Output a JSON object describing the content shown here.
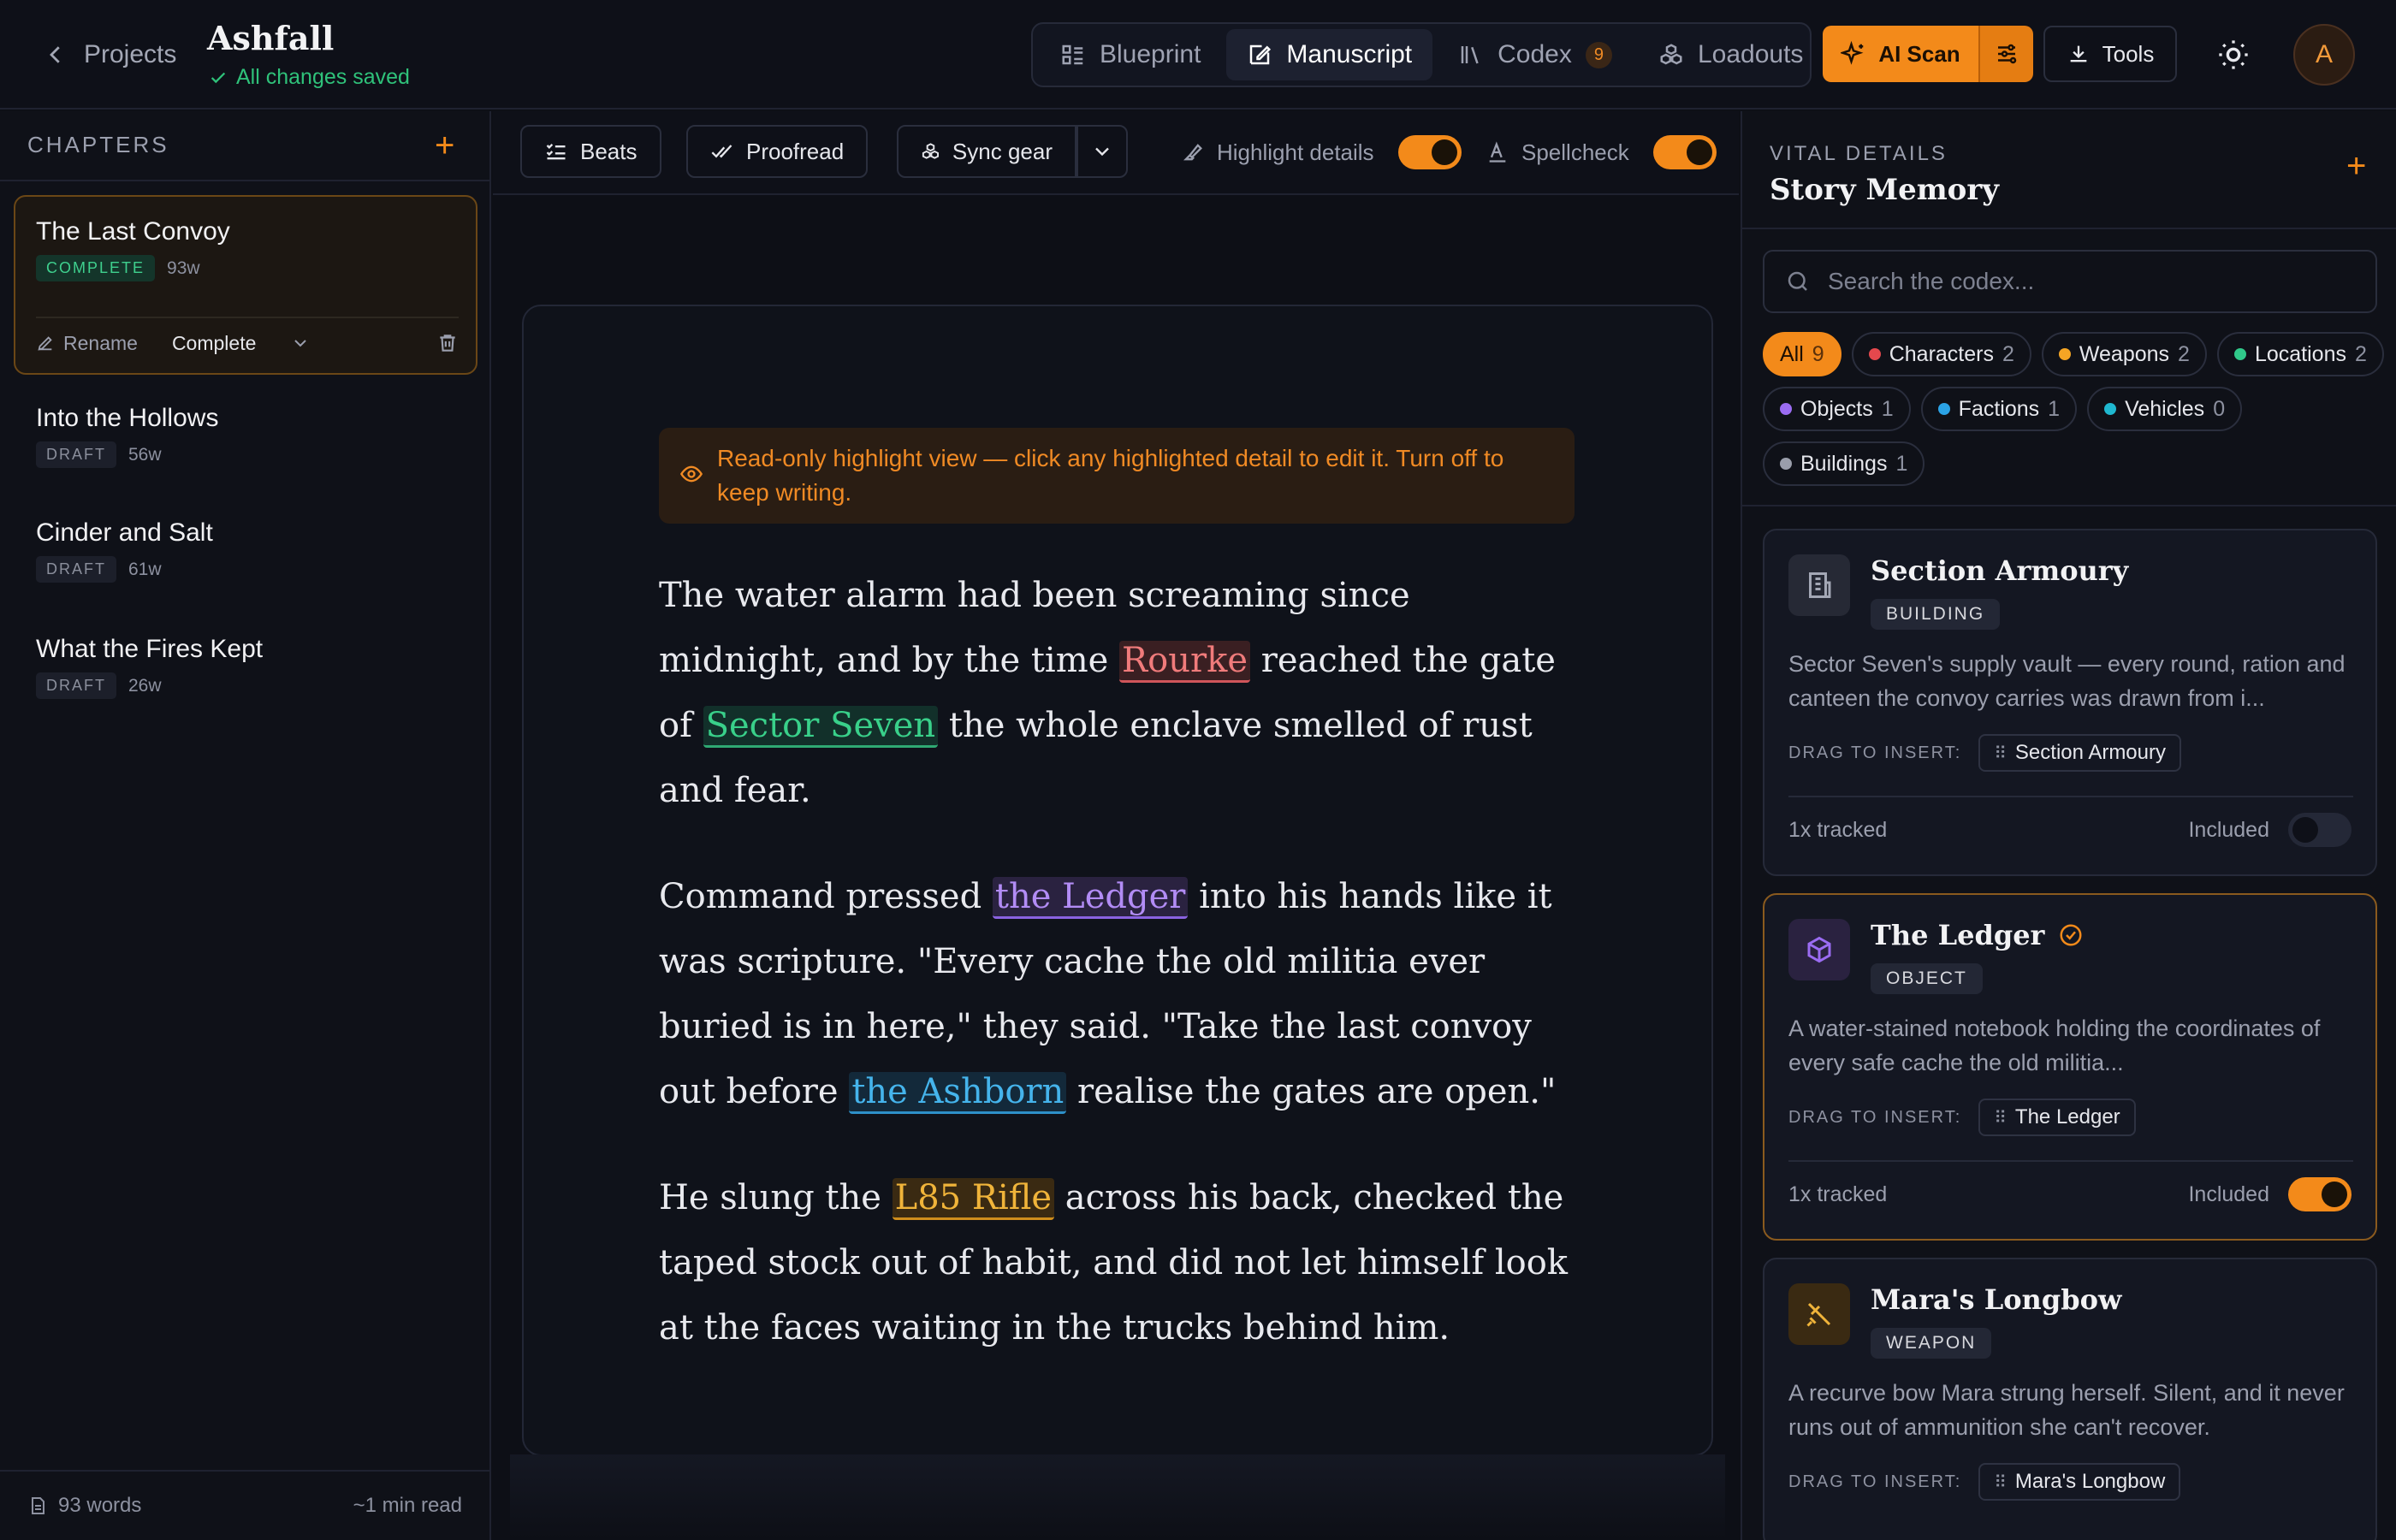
{
  "topbar": {
    "back_label": "Projects",
    "title": "Ashfall",
    "saved_status": "All changes saved",
    "modes": [
      {
        "label": "Blueprint"
      },
      {
        "label": "Manuscript"
      },
      {
        "label": "Codex",
        "badge": "9"
      },
      {
        "label": "Loadouts"
      }
    ],
    "ai_scan_label": "AI Scan",
    "tools_label": "Tools",
    "avatar_initial": "A"
  },
  "sidebar": {
    "header": "CHAPTERS",
    "chapters": [
      {
        "name": "The Last Convoy",
        "status": "COMPLETE",
        "words": "93w"
      },
      {
        "name": "Into the Hollows",
        "status": "DRAFT",
        "words": "56w"
      },
      {
        "name": "Cinder and Salt",
        "status": "DRAFT",
        "words": "61w"
      },
      {
        "name": "What the Fires Kept",
        "status": "DRAFT",
        "words": "26w"
      }
    ],
    "rename_label": "Rename",
    "status_select": "Complete",
    "footer_words": "93 words",
    "footer_read": "~1 min read"
  },
  "toolbar": {
    "beats": "Beats",
    "proofread": "Proofread",
    "sync_gear": "Sync gear",
    "highlight_details": "Highlight details",
    "spellcheck": "Spellcheck"
  },
  "editor": {
    "notice": "Read-only highlight view — click any highlighted detail to edit it. Turn off to keep writing.",
    "p1": {
      "a": "The water alarm had been screaming since midnight, and by the time ",
      "h1": "Rourke",
      "b": " reached the gate of ",
      "h2": "Sector Seven",
      "c": " the whole enclave smelled of rust and fear."
    },
    "p2": {
      "a": "Command pressed ",
      "h1": "the Ledger",
      "b": " into his hands like it was scripture. \"Every cache the old militia ever buried is in here,\" they said. \"Take the last convoy out before ",
      "h2": "the Ashborn",
      "c": " realise the gates are open.\""
    },
    "p3": {
      "a": "He slung the ",
      "h1": "L85 Rifle",
      "b": " across his back, checked the taped stock out of habit, and did not let himself look at the faces waiting in the trucks behind him."
    }
  },
  "panel": {
    "label": "VITAL DETAILS",
    "title": "Story Memory",
    "search_placeholder": "Search the codex...",
    "filters": [
      {
        "label": "All",
        "count": "9",
        "color": ""
      },
      {
        "label": "Characters",
        "count": "2",
        "color": "#e5484d"
      },
      {
        "label": "Weapons",
        "count": "2",
        "color": "#f5a524"
      },
      {
        "label": "Locations",
        "count": "2",
        "color": "#30c98a"
      },
      {
        "label": "Objects",
        "count": "1",
        "color": "#9b6cf2"
      },
      {
        "label": "Factions",
        "count": "1",
        "color": "#2ba3e6"
      },
      {
        "label": "Vehicles",
        "count": "0",
        "color": "#1fb8d0"
      },
      {
        "label": "Buildings",
        "count": "1",
        "color": "#9a9eab"
      }
    ],
    "drag_label": "DRAG TO INSERT:",
    "included_label": "Included",
    "cards": [
      {
        "name": "Section Armoury",
        "type": "BUILDING",
        "desc": "Sector Seven's supply vault — every round, ration and canteen the convoy carries was drawn from i...",
        "pill": "Section Armoury",
        "tracked": "1x tracked",
        "included": false
      },
      {
        "name": "The Ledger",
        "type": "OBJECT",
        "desc": "A water-stained notebook holding the coordinates of every safe cache the old militia...",
        "pill": "The Ledger",
        "tracked": "1x tracked",
        "included": true
      },
      {
        "name": "Mara's Longbow",
        "type": "WEAPON",
        "desc": "A recurve bow Mara strung herself. Silent, and it never runs out of ammunition she can't recover.",
        "pill": "Mara's Longbow"
      }
    ]
  }
}
